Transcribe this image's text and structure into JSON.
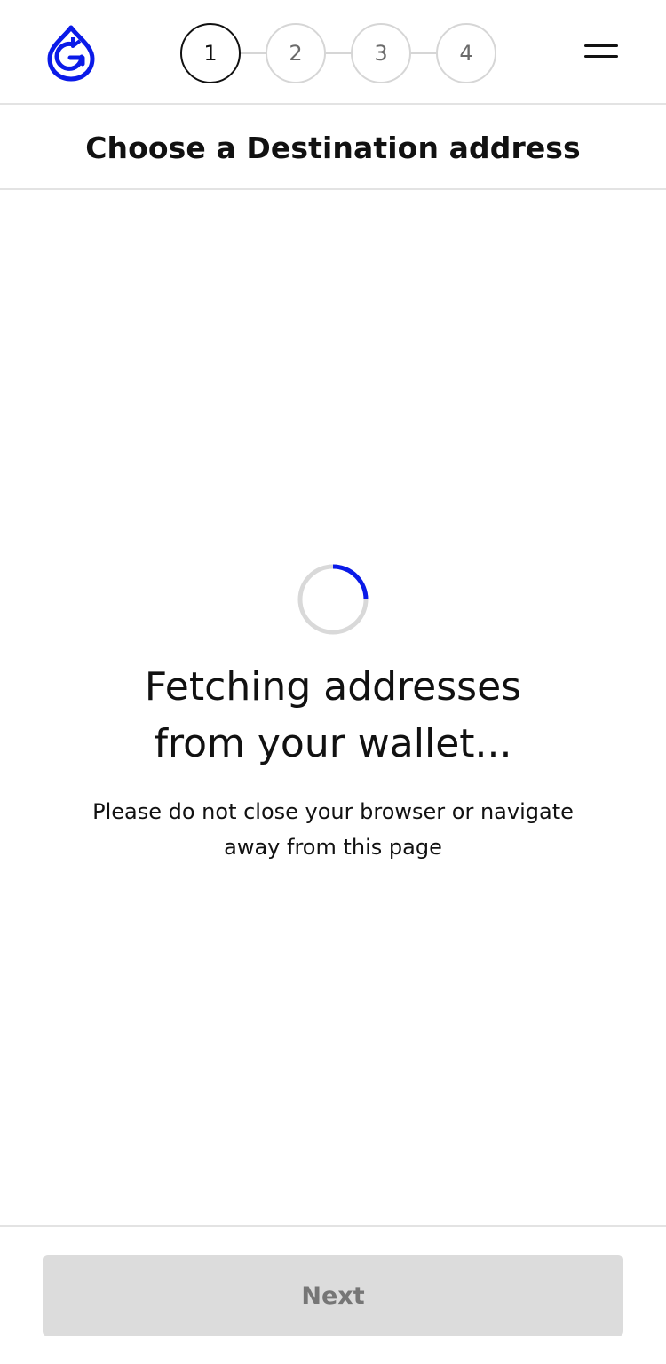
{
  "header": {
    "logo_icon": "drop-g-logo-icon",
    "brand_color": "#0a1ae8",
    "steps": [
      {
        "label": "1",
        "state": "active"
      },
      {
        "label": "2",
        "state": "inactive"
      },
      {
        "label": "3",
        "state": "inactive"
      },
      {
        "label": "4",
        "state": "inactive"
      }
    ],
    "menu_icon": "hamburger-menu-icon"
  },
  "title": "Choose a Destination address",
  "loading": {
    "spinner_color": "#0a1ae8",
    "spinner_track_color": "#d9d9d9",
    "heading_line1": "Fetching addresses",
    "heading_line2": "from your wallet...",
    "subtext": "Please do not close your browser or navigate away from this page"
  },
  "footer": {
    "next_label": "Next",
    "next_disabled": true
  }
}
